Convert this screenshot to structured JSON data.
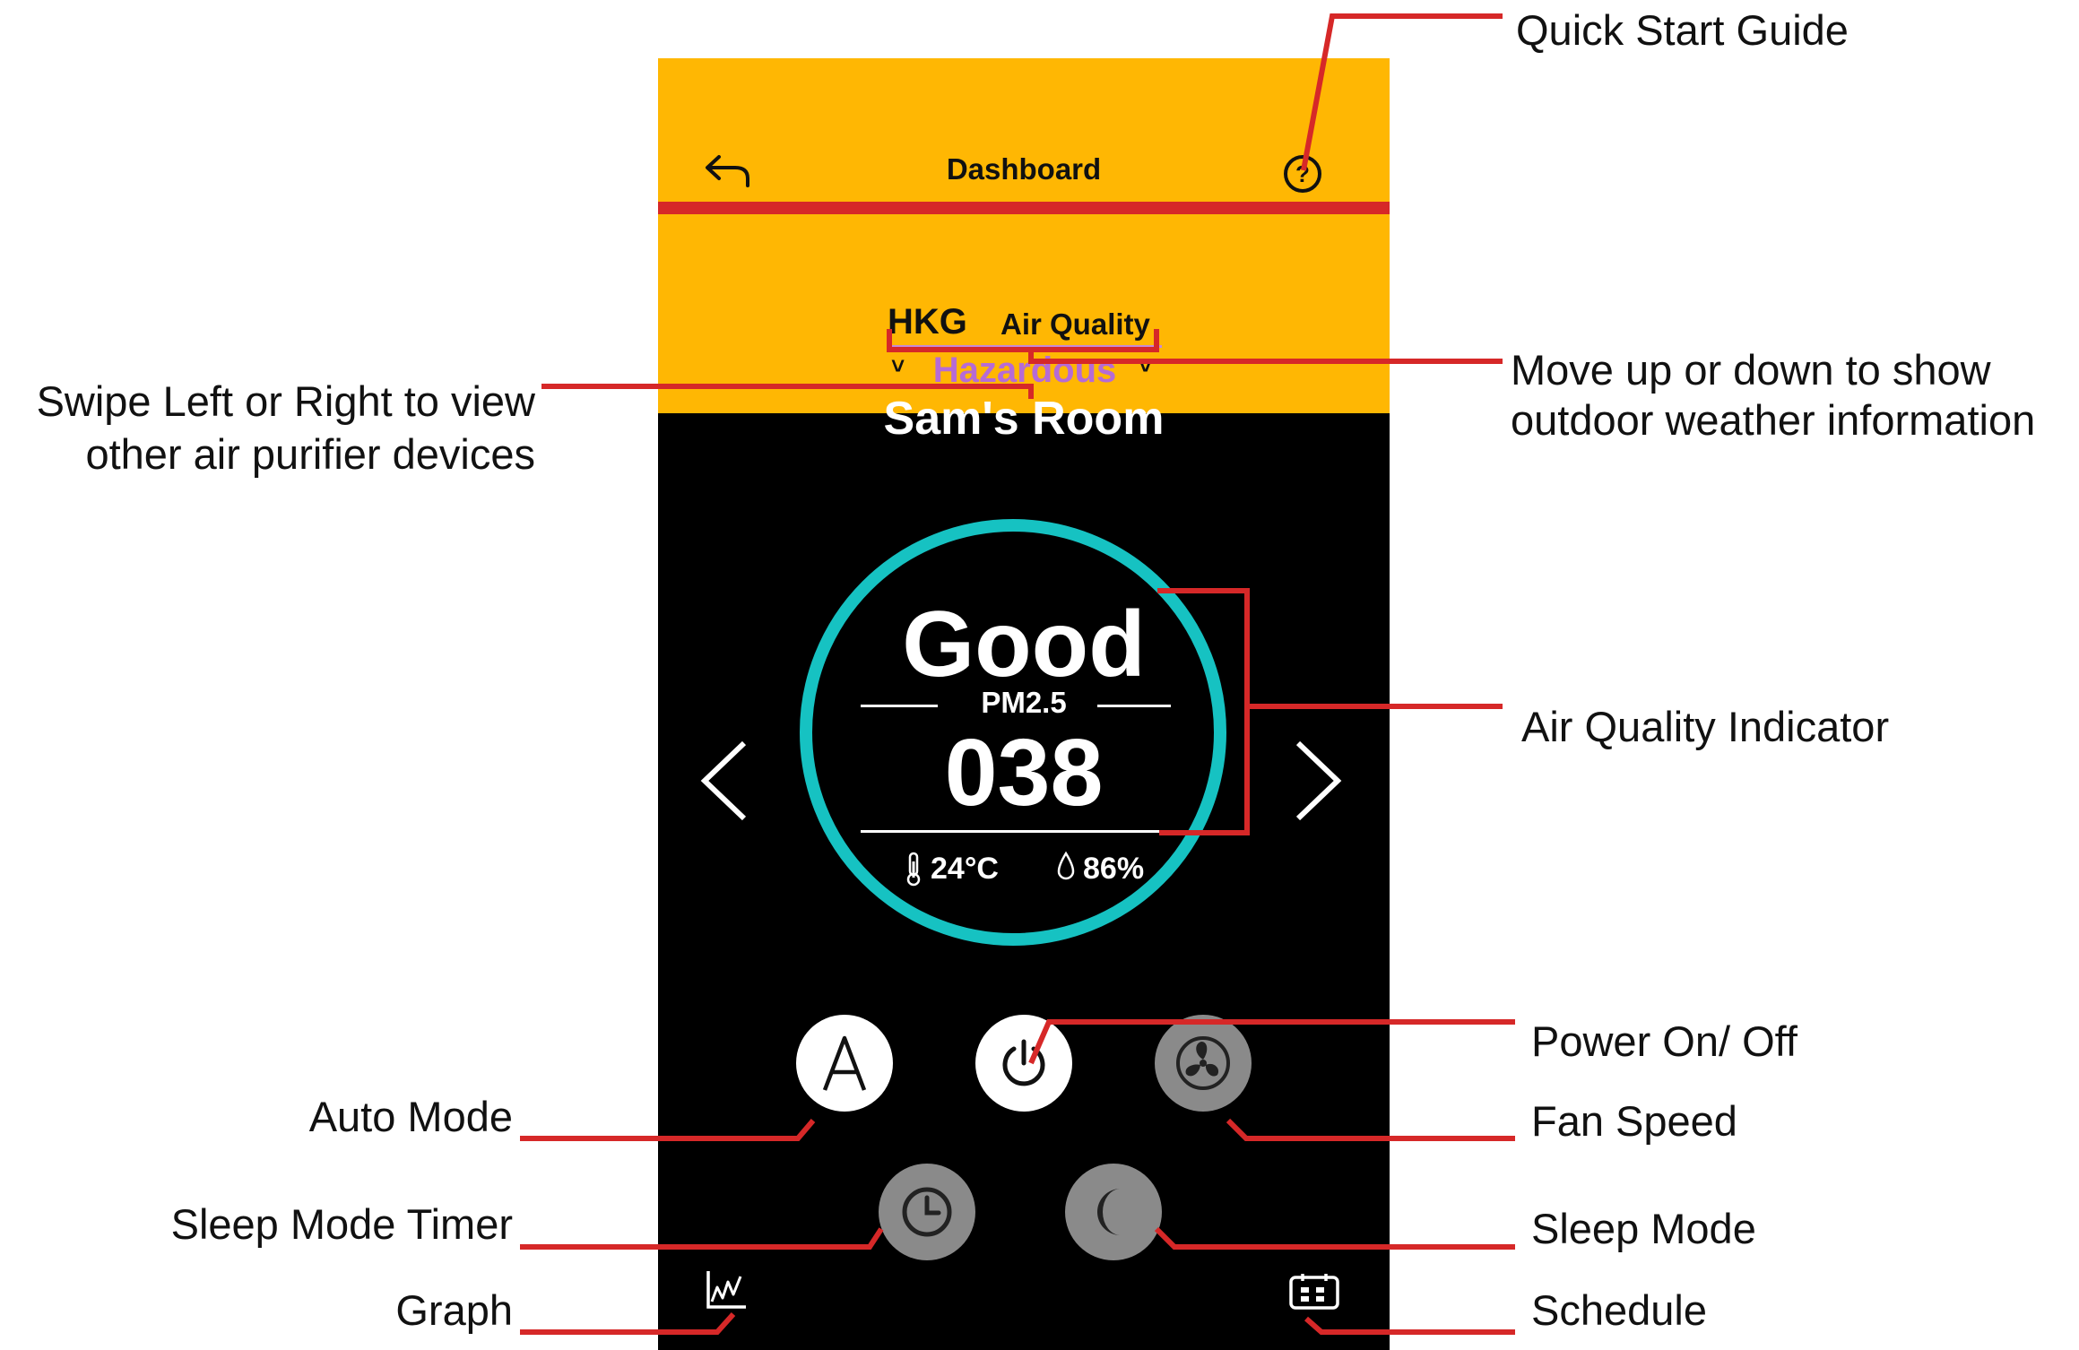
{
  "header": {
    "title": "Dashboard"
  },
  "outdoor": {
    "city": "HKG",
    "label": "Air Quality",
    "status": "Hazardous"
  },
  "device": {
    "name": "Sam's Room"
  },
  "indicator": {
    "status": "Good",
    "metric": "PM2.5",
    "value": "038",
    "temperature": "24°C",
    "humidity": "86%"
  },
  "callouts": {
    "quick_start": "Quick Start Guide",
    "move_updown_1": "Move up or down to show",
    "move_updown_2": "outdoor weather information",
    "swipe_1": "Swipe Left or Right to view",
    "swipe_2": "other air purifier devices",
    "aq_indicator": "Air Quality Indicator",
    "power": "Power On/ Off",
    "fan": "Fan Speed",
    "auto": "Auto Mode",
    "sleep_timer": "Sleep Mode Timer",
    "sleep": "Sleep Mode",
    "graph": "Graph",
    "schedule": "Schedule"
  },
  "colors": {
    "accent": "#ffb703",
    "red": "#d62828",
    "ring": "#16c2c2",
    "hazard": "#b56bd6"
  },
  "icons": [
    "back-arrow-icon",
    "help-icon",
    "chevron-left-icon",
    "chevron-right-icon",
    "thermometer-icon",
    "droplet-icon",
    "auto-mode-icon",
    "power-icon",
    "fan-icon",
    "timer-icon",
    "moon-icon",
    "graph-icon",
    "calendar-icon"
  ]
}
